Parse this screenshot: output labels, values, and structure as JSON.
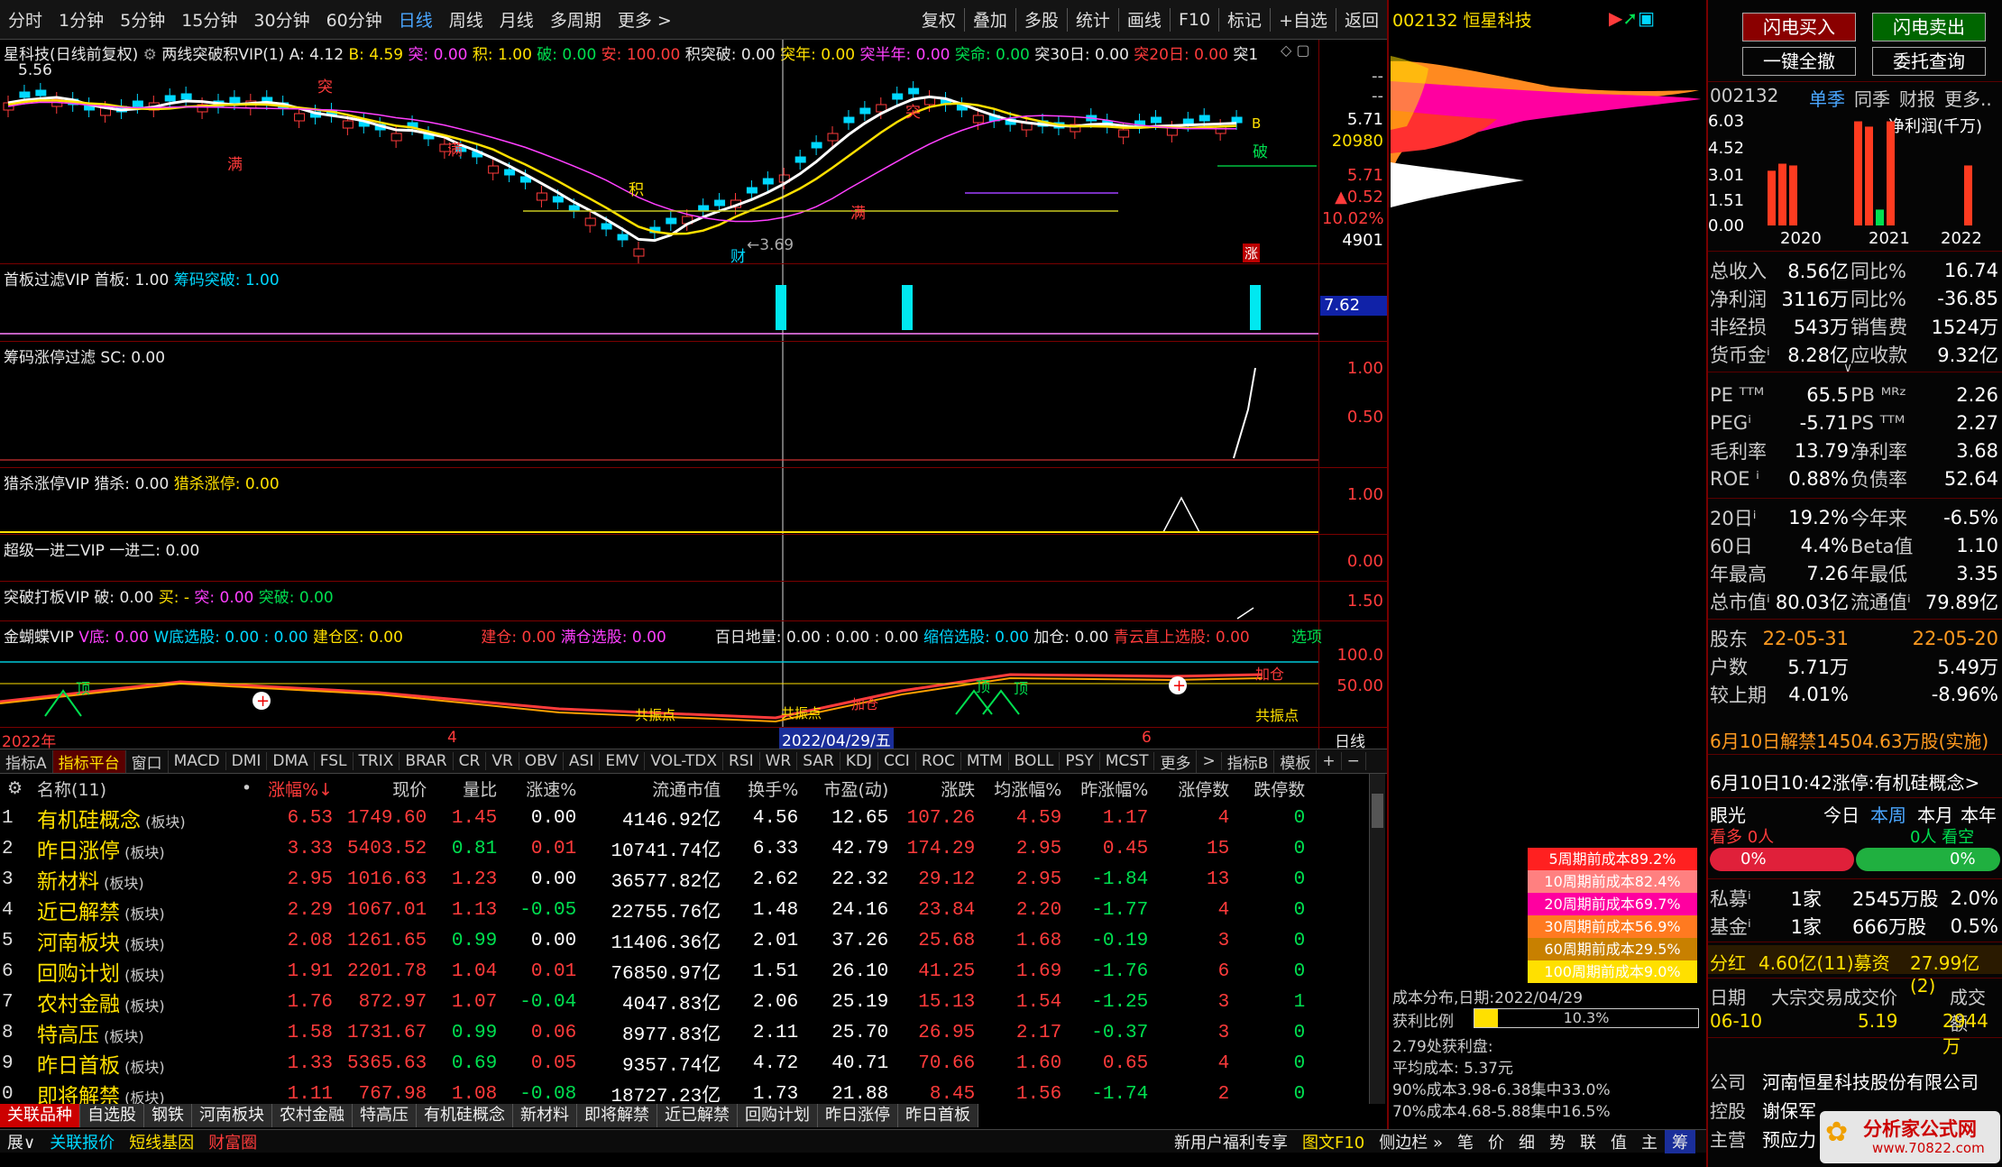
{
  "toolbar": {
    "periods": [
      "分时",
      "1分钟",
      "5分钟",
      "15分钟",
      "30分钟",
      "60分钟",
      "日线",
      "周线",
      "月线",
      "多周期",
      "更多 >"
    ],
    "active": "日线",
    "right": [
      "复权",
      "叠加",
      "多股",
      "统计",
      "画线",
      "F10",
      "标记",
      "+自选",
      "返回"
    ]
  },
  "main_chart": {
    "title_stock": "星科技(日线前复权)",
    "indicator": "两线突破积VIP(1)",
    "params": [
      {
        "k": "A:",
        "v": "4.12",
        "c": "wht"
      },
      {
        "k": "B:",
        "v": "4.59",
        "c": "yel"
      },
      {
        "k": "突:",
        "v": "0.00",
        "c": "mag"
      },
      {
        "k": "积:",
        "v": "1.00",
        "c": "yel"
      },
      {
        "k": "破:",
        "v": "0.00",
        "c": "grn"
      },
      {
        "k": "安:",
        "v": "100.00",
        "c": "red"
      },
      {
        "k": "积突破:",
        "v": "0.00",
        "c": "wht"
      },
      {
        "k": "突年:",
        "v": "0.00",
        "c": "yel"
      },
      {
        "k": "突半年:",
        "v": "0.00",
        "c": "mag"
      },
      {
        "k": "突命:",
        "v": "0.00",
        "c": "grn"
      },
      {
        "k": "突30日:",
        "v": "0.00",
        "c": "wht"
      },
      {
        "k": "突20日:",
        "v": "0.00",
        "c": "red"
      },
      {
        "k": "突1",
        "v": "",
        "c": "wht"
      }
    ],
    "top_label": "5.56",
    "low_label": "←3.69",
    "marks": [
      "突",
      "满",
      "满",
      "积",
      "满",
      "突",
      "破",
      "财",
      "涨",
      "B"
    ],
    "axis": [
      "--",
      "--",
      "5.71",
      "20980",
      "5.71",
      "▲0.52",
      "10.02%",
      "4901"
    ]
  },
  "panels": [
    {
      "title": "首板过滤VIP",
      "parts": [
        {
          "t": "首板: 1.00",
          "c": "wht"
        },
        {
          "t": "筹码突破: 1.00",
          "c": "cyn"
        }
      ],
      "axis": [
        "7.62"
      ]
    },
    {
      "title": "筹码涨停过滤",
      "parts": [
        {
          "t": "SC: 0.00",
          "c": "wht"
        }
      ],
      "axis": [
        "1.00",
        "0.50"
      ]
    },
    {
      "title": "猎杀涨停VIP",
      "parts": [
        {
          "t": "猎杀: 0.00",
          "c": "wht"
        },
        {
          "t": "猎杀涨停: 0.00",
          "c": "yel"
        }
      ],
      "axis": [
        "1.00"
      ]
    },
    {
      "title": "超级一进二VIP",
      "parts": [
        {
          "t": "一进二: 0.00",
          "c": "wht"
        }
      ],
      "axis": [
        "0.00"
      ]
    },
    {
      "title": "突破打板VIP",
      "parts": [
        {
          "t": "破: 0.00",
          "c": "wht"
        },
        {
          "t": "买: -",
          "c": "yel"
        },
        {
          "t": "突: 0.00",
          "c": "mag"
        },
        {
          "t": "突破: 0.00",
          "c": "grn"
        }
      ],
      "axis": [
        "1.50"
      ]
    },
    {
      "title": "金蝴蝶VIP",
      "parts": [
        {
          "t": "V底: 0.00",
          "c": "mag"
        },
        {
          "t": "W底选股: 0.00 : 0.00",
          "c": "cyn"
        },
        {
          "t": "建仓区: 0.00",
          "c": "yel"
        },
        {
          "t": "建仓: 0.00",
          "c": "red"
        },
        {
          "t": "满仓选股: 0.00",
          "c": "mag"
        },
        {
          "t": "百日地量: 0.00 : 0.00 : 0.00",
          "c": "wht"
        },
        {
          "t": "缩倍选股: 0.00",
          "c": "cyn"
        },
        {
          "t": "加仓: 0.00",
          "c": "wht"
        },
        {
          "t": "青云直上选股: 0.00",
          "c": "red"
        },
        {
          "t": "选项",
          "c": "grn"
        }
      ],
      "axis": [
        "100.0",
        "50.00"
      ],
      "marks": [
        "顶",
        "共振点",
        "共振点",
        "加仓",
        "顶",
        "顶",
        "加仓",
        "共振点"
      ]
    }
  ],
  "timeaxis": {
    "labels": [
      "2022年",
      "4",
      "2022/04/29/五",
      "6"
    ],
    "right": "日线"
  },
  "indicator_tabs": [
    "指标A",
    "指标平台",
    "窗口",
    "MACD",
    "DMI",
    "DMA",
    "FSL",
    "TRIX",
    "BRAR",
    "CR",
    "VR",
    "OBV",
    "ASI",
    "EMV",
    "VOL-TDX",
    "RSI",
    "WR",
    "SAR",
    "KDJ",
    "CCI",
    "ROC",
    "MTM",
    "BOLL",
    "PSY",
    "MCST",
    "更多",
    ">",
    "指标B",
    "模板",
    "+",
    "−"
  ],
  "table": {
    "headers": [
      "名称(11)",
      "•",
      "涨幅%↓",
      "现价",
      "量比",
      "涨速%",
      "流通市值",
      "换手%",
      "市盈(动)",
      "涨跌",
      "均涨幅%",
      "昨涨幅%",
      "涨停数",
      "跌停数"
    ],
    "rows": [
      [
        "1",
        "有机硅概念",
        "6.53",
        "1749.60",
        "1.45",
        "0.00",
        "4146.92亿",
        "4.56",
        "12.65",
        "107.26",
        "4.59",
        "1.17",
        "4",
        "0"
      ],
      [
        "2",
        "昨日涨停",
        "3.33",
        "5403.52",
        "0.81",
        "0.01",
        "10741.74亿",
        "6.33",
        "42.79",
        "174.29",
        "2.95",
        "0.45",
        "15",
        "0"
      ],
      [
        "3",
        "新材料",
        "2.95",
        "1016.63",
        "1.23",
        "0.00",
        "36577.82亿",
        "2.62",
        "22.32",
        "29.12",
        "2.95",
        "-1.84",
        "13",
        "0"
      ],
      [
        "4",
        "近已解禁",
        "2.29",
        "1067.01",
        "1.13",
        "-0.05",
        "22755.76亿",
        "1.48",
        "24.16",
        "23.84",
        "2.20",
        "-1.77",
        "4",
        "0"
      ],
      [
        "5",
        "河南板块",
        "2.08",
        "1261.65",
        "0.99",
        "0.00",
        "11406.36亿",
        "2.01",
        "37.26",
        "25.68",
        "1.68",
        "-0.19",
        "3",
        "0"
      ],
      [
        "6",
        "回购计划",
        "1.91",
        "2201.78",
        "1.04",
        "0.01",
        "76850.97亿",
        "1.51",
        "26.10",
        "41.25",
        "1.69",
        "-1.76",
        "6",
        "0"
      ],
      [
        "7",
        "农村金融",
        "1.76",
        "872.97",
        "1.07",
        "-0.04",
        "4047.83亿",
        "2.06",
        "25.19",
        "15.13",
        "1.54",
        "-1.25",
        "3",
        "1"
      ],
      [
        "8",
        "特高压",
        "1.58",
        "1731.67",
        "0.99",
        "0.06",
        "8977.83亿",
        "2.11",
        "25.70",
        "26.95",
        "2.17",
        "-0.37",
        "3",
        "0"
      ],
      [
        "9",
        "昨日首板",
        "1.33",
        "5365.63",
        "0.69",
        "0.05",
        "9357.74亿",
        "4.72",
        "40.71",
        "70.66",
        "1.60",
        "0.65",
        "4",
        "0"
      ],
      [
        "0",
        "即将解禁",
        "1.11",
        "767.98",
        "1.08",
        "-0.08",
        "18727.23亿",
        "1.73",
        "21.88",
        "8.45",
        "1.56",
        "-1.74",
        "2",
        "0"
      ]
    ],
    "suffix": "(板块)"
  },
  "bottom_tabs": [
    "关联品种",
    "自选股",
    "钢铁",
    "河南板块",
    "农村金融",
    "特高压",
    "有机硅概念",
    "新材料",
    "即将解禁",
    "近已解禁",
    "回购计划",
    "昨日涨停",
    "昨日首板"
  ],
  "status_bar": {
    "left": [
      "展∨",
      "关联报价",
      "短线基因",
      "财富圈"
    ],
    "right": [
      "新用户福利专享",
      "图文F10",
      "侧边栏 »",
      "笔",
      "价",
      "细",
      "势",
      "联",
      "值",
      "主",
      "筹"
    ]
  },
  "mid_panel": {
    "stock": "002132 恒星科技",
    "cost_labels": [
      {
        "t": "5周期前成本89.2%",
        "c": "#ff2020"
      },
      {
        "t": "10周期前成本82.4%",
        "c": "#ff8080"
      },
      {
        "t": "20周期前成本69.7%",
        "c": "#ff00a0"
      },
      {
        "t": "30周期前成本56.9%",
        "c": "#ff7a20"
      },
      {
        "t": "60周期前成本29.5%",
        "c": "#c88000"
      },
      {
        "t": "100周期前成本9.0%",
        "c": "#ffe000"
      }
    ],
    "cost_date": "成本分布,日期:2022/04/29",
    "profit_ratio": "获利比例",
    "profit_val": "10.3%",
    "profit_fill": 0.103,
    "lines": [
      "2.79处获利盘:",
      "平均成本: 5.37元",
      "90%成本3.98-6.38集中33.0%",
      "70%成本4.68-5.88集中16.5%"
    ]
  },
  "right_panel": {
    "btn_buy": "闪电买入",
    "btn_sell": "闪电卖出",
    "btn_all": "一键全撤",
    "btn_query": "委托查询",
    "code": "002132",
    "tabs": [
      "单季",
      "同季",
      "财报",
      "更多.."
    ],
    "chart_title": "净利润(千万)",
    "yticks": [
      "6.03",
      "4.52",
      "3.01",
      "1.51",
      "0.00"
    ],
    "years": [
      "2020",
      "2021",
      "2022"
    ],
    "chart_data": {
      "type": "bar",
      "title": "净利润(千万)",
      "categories": [
        "2020Q1",
        "2020Q2",
        "2020Q3",
        "2020Q4",
        "2021Q1",
        "2021Q2",
        "2021Q3",
        "2021Q4",
        "2022Q1"
      ],
      "values": [
        3.1,
        3.5,
        3.4,
        0,
        5.9,
        5.6,
        0.9,
        5.9,
        3.4
      ],
      "colors": [
        "#ff3b20",
        "#ff3b20",
        "#ff3b20",
        "#ff3b20",
        "#ff3b20",
        "#ff3b20",
        "#00e050",
        "#ff3b20",
        "#ff3b20"
      ],
      "ylim": [
        0,
        6.03
      ]
    },
    "fin": [
      {
        "k": "总收入",
        "v": "8.56亿",
        "k2": "同比%",
        "v2": "16.74",
        "c": "wht"
      },
      {
        "k": "净利润",
        "v": "3116万",
        "k2": "同比%",
        "v2": "-36.85",
        "c": "wht"
      },
      {
        "k": "非经损",
        "v": "543万",
        "k2": "销售费",
        "v2": "1524万",
        "c": "wht"
      },
      {
        "k": "货币金ⁱ",
        "v": "8.28亿",
        "k2": "应收款",
        "v2": "9.32亿",
        "c": "wht"
      }
    ],
    "val": [
      {
        "k": "PE ᵀᵀᴹ",
        "v": "65.5",
        "k2": "PB ᴹᴿᶻ",
        "v2": "2.26",
        "c": "wht"
      },
      {
        "k": "PEGⁱ",
        "v": "-5.71",
        "k2": "PS ᵀᵀᴹ",
        "v2": "2.27",
        "c": "wht"
      },
      {
        "k": "毛利率",
        "v": "13.79",
        "k2": "净利率",
        "v2": "3.68",
        "c": "wht"
      },
      {
        "k": "ROE ⁱ",
        "v": "0.88%",
        "k2": "负债率",
        "v2": "52.64",
        "c": "wht"
      }
    ],
    "perf": [
      {
        "k": "20日ⁱ",
        "v": "19.2%",
        "k2": "今年来",
        "v2": "-6.5%",
        "c": "wht"
      },
      {
        "k": "60日",
        "v": "4.4%",
        "k2": "Beta值",
        "v2": "1.10",
        "c": "wht"
      },
      {
        "k": "年最高",
        "v": "7.26",
        "k2": "年最低",
        "v2": "3.35",
        "c": "wht"
      },
      {
        "k": "总市值ⁱ",
        "v": "80.03亿",
        "k2": "流通值ⁱ",
        "v2": "79.89亿",
        "c": "wht"
      }
    ],
    "holders": [
      {
        "k": "股东",
        "v": "22-05-31",
        "k2": "",
        "v2": "22-05-20",
        "c": "org"
      },
      {
        "k": "户数",
        "v": "5.71万",
        "k2": "",
        "v2": "5.49万",
        "c": "wht"
      },
      {
        "k": "较上期",
        "v": "4.01%",
        "k2": "",
        "v2": "-8.96%",
        "c": "wht"
      }
    ],
    "notice1": "6月10日解禁14504.63万股(实施)",
    "notice2": "6月10日10:42涨停:有机硅概念>",
    "eye": "眼光",
    "periods": [
      "今日",
      "本周",
      "本月",
      "本年"
    ],
    "kan": "看多 0人",
    "kan2": "0人 看空",
    "bar_l": "0%",
    "bar_r": "0%",
    "funds": [
      {
        "k": "私募ⁱ",
        "v": "1家",
        "k2": "2545万股",
        "v2": "2.0%",
        "c": "wht"
      },
      {
        "k": "基金ⁱ",
        "v": "1家",
        "k2": "666万股",
        "v2": "0.5%",
        "c": "wht"
      }
    ],
    "div": {
      "k": "分红",
      "v": "4.60亿(11)募资",
      "v2": "27.99亿(2)"
    },
    "block": {
      "h1": "日期",
      "h2": "大宗交易成交价",
      "h3": "成交额",
      "d": "06-10",
      "p": "5.19",
      "a": "2944万"
    },
    "company": [
      {
        "k": "公司",
        "v": "河南恒星科技股份有限公司"
      },
      {
        "k": "控股",
        "v": "谢保军"
      },
      {
        "k": "主营",
        "v": "预应力"
      }
    ],
    "logo": "分析家公式网",
    "logo_url": "www.70822.com"
  }
}
